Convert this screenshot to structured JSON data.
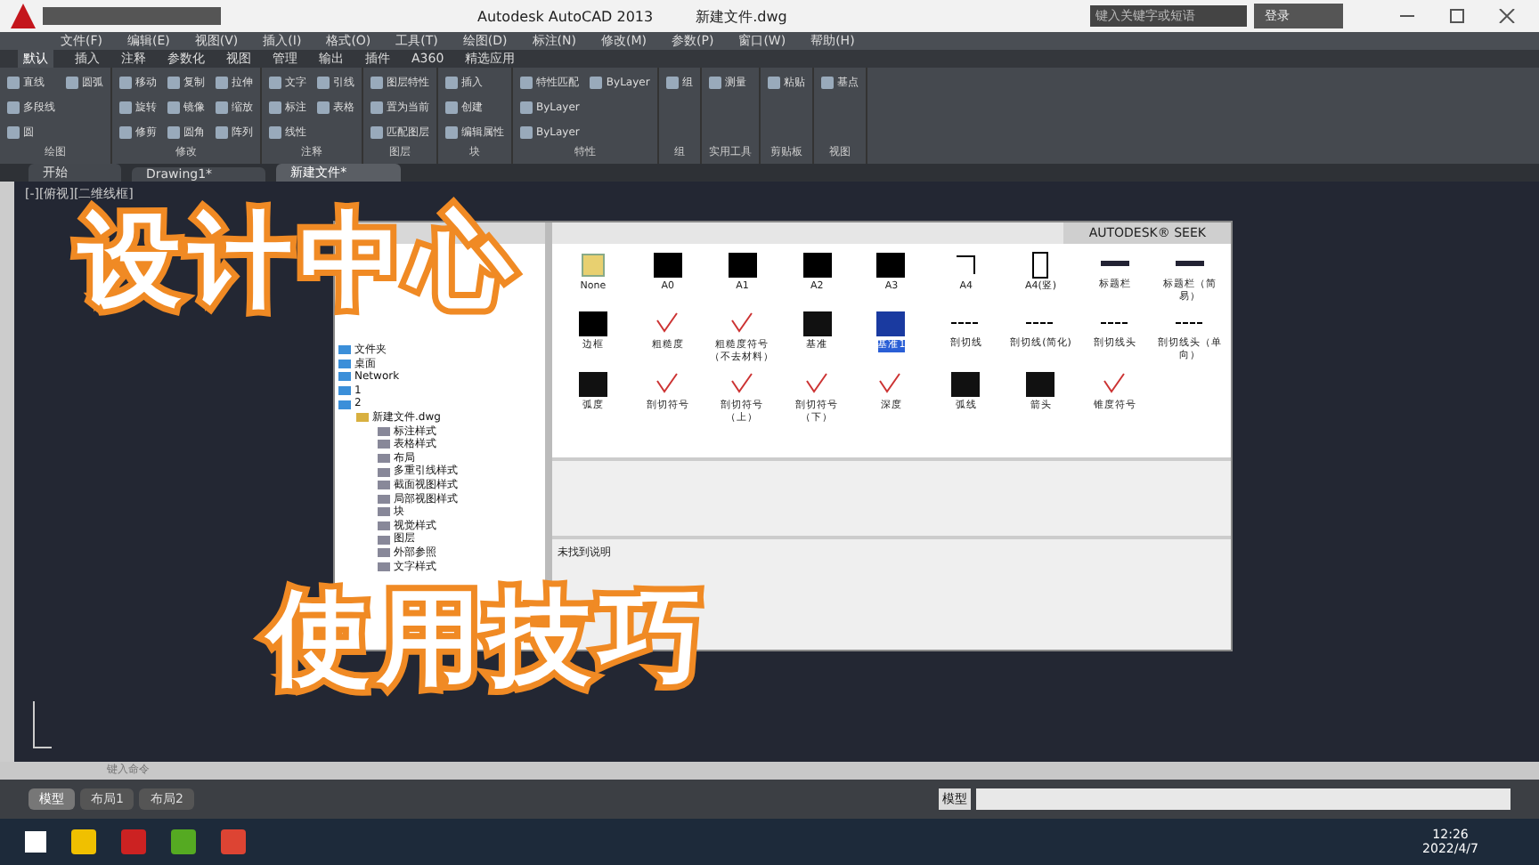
{
  "window": {
    "title": "Autodesk AutoCAD 2013",
    "file": "新建文件.dwg",
    "search_placeholder": "键入关键字或短语",
    "sign_in": "登录"
  },
  "menu": [
    "文件(F)",
    "编辑(E)",
    "视图(V)",
    "插入(I)",
    "格式(O)",
    "工具(T)",
    "绘图(D)",
    "标注(N)",
    "修改(M)",
    "参数(P)",
    "窗口(W)",
    "帮助(H)"
  ],
  "ribbon_tabs": [
    {
      "label": "默认",
      "selected": true
    },
    {
      "label": "插入",
      "selected": false
    },
    {
      "label": "注释",
      "selected": false
    },
    {
      "label": "参数化",
      "selected": false
    },
    {
      "label": "视图",
      "selected": false
    },
    {
      "label": "管理",
      "selected": false
    },
    {
      "label": "输出",
      "selected": false
    },
    {
      "label": "插件",
      "selected": false
    },
    {
      "label": "A360",
      "selected": false
    },
    {
      "label": "精选应用",
      "selected": false
    }
  ],
  "ribbon_panels": [
    {
      "label": "绘图",
      "tools": [
        "直线",
        "多段线",
        "圆",
        "圆弧"
      ]
    },
    {
      "label": "修改",
      "tools": [
        "移动",
        "旋转",
        "修剪",
        "复制",
        "镜像",
        "圆角",
        "拉伸",
        "缩放",
        "阵列"
      ]
    },
    {
      "label": "注释",
      "tools": [
        "文字",
        "标注",
        "线性",
        "引线",
        "表格"
      ]
    },
    {
      "label": "图层",
      "tools": [
        "图层特性",
        "置为当前",
        "匹配图层"
      ]
    },
    {
      "label": "块",
      "tools": [
        "插入",
        "创建",
        "编辑属性"
      ]
    },
    {
      "label": "特性",
      "tools": [
        "特性匹配",
        "ByLayer",
        "ByLayer",
        "ByLayer"
      ]
    },
    {
      "label": "组",
      "tools": [
        "组"
      ]
    },
    {
      "label": "实用工具",
      "tools": [
        "测量"
      ]
    },
    {
      "label": "剪贴板",
      "tools": [
        "粘贴"
      ]
    },
    {
      "label": "视图",
      "tools": [
        "基点"
      ]
    }
  ],
  "doc_tabs": [
    {
      "label": "开始",
      "selected": false
    },
    {
      "label": "Drawing1*",
      "selected": false
    },
    {
      "label": "新建文件*",
      "selected": true
    }
  ],
  "viewport": {
    "label": "[-][俯视][二维线框]"
  },
  "design_center": {
    "seek": "AUTODESK® SEEK",
    "tree": [
      {
        "label": "文件夹"
      },
      {
        "label": "桌面"
      },
      {
        "label": "Network"
      },
      {
        "label": "1"
      },
      {
        "label": "2",
        "children": [
          {
            "label": "新建文件.dwg",
            "children": [
              {
                "label": "标注样式"
              },
              {
                "label": "表格样式"
              },
              {
                "label": "布局"
              },
              {
                "label": "多重引线样式"
              },
              {
                "label": "截面视图样式"
              },
              {
                "label": "局部视图样式"
              },
              {
                "label": "块"
              },
              {
                "label": "视觉样式"
              },
              {
                "label": "图层"
              },
              {
                "label": "外部参照"
              },
              {
                "label": "文字样式"
              }
            ]
          }
        ]
      }
    ],
    "items": [
      {
        "label": "None",
        "kind": "file",
        "selected": false
      },
      {
        "label": "A0",
        "kind": "frame",
        "selected": false
      },
      {
        "label": "A1",
        "kind": "frame",
        "selected": false
      },
      {
        "label": "A2",
        "kind": "frame",
        "selected": false
      },
      {
        "label": "A3",
        "kind": "frame",
        "selected": false
      },
      {
        "label": "A4",
        "kind": "corner",
        "selected": false
      },
      {
        "label": "A4(竖)",
        "kind": "portrait",
        "selected": false
      },
      {
        "label": "标题栏",
        "kind": "bar",
        "selected": false
      },
      {
        "label": "标题栏（简易）",
        "kind": "bar",
        "selected": false
      },
      {
        "label": "边框",
        "kind": "frame",
        "selected": false
      },
      {
        "label": "粗糙度",
        "kind": "mark",
        "selected": false
      },
      {
        "label": "粗糙度符号（不去材料）",
        "kind": "mark",
        "selected": false
      },
      {
        "label": "基准",
        "kind": "dark",
        "selected": false
      },
      {
        "label": "基准1",
        "kind": "dark",
        "selected": true
      },
      {
        "label": "剖切线",
        "kind": "line",
        "selected": false
      },
      {
        "label": "剖切线(简化)",
        "kind": "line",
        "selected": false
      },
      {
        "label": "剖切线头",
        "kind": "line",
        "selected": false
      },
      {
        "label": "剖切线头（单向）",
        "kind": "line",
        "selected": false
      },
      {
        "label": "弧度",
        "kind": "dark",
        "selected": false
      },
      {
        "label": "剖切符号",
        "kind": "mark",
        "selected": false
      },
      {
        "label": "剖切符号（上）",
        "kind": "mark",
        "selected": false
      },
      {
        "label": "剖切符号（下）",
        "kind": "mark",
        "selected": false
      },
      {
        "label": "深度",
        "kind": "mark",
        "selected": false
      },
      {
        "label": "弧线",
        "kind": "dark",
        "selected": false
      },
      {
        "label": "箭头",
        "kind": "dark",
        "selected": false
      },
      {
        "label": "锥度符号",
        "kind": "mark",
        "selected": false
      }
    ],
    "description": "未找到说明"
  },
  "captions": [
    "设计中心",
    "使用技巧"
  ],
  "command": {
    "placeholder": "键入命令"
  },
  "layout_tabs": [
    {
      "label": "模型",
      "selected": true
    },
    {
      "label": "布局1",
      "selected": false
    },
    {
      "label": "布局2",
      "selected": false
    }
  ],
  "status": {
    "space": "模型"
  },
  "taskbar": {
    "time": "12:26",
    "date": "2022/4/7"
  }
}
